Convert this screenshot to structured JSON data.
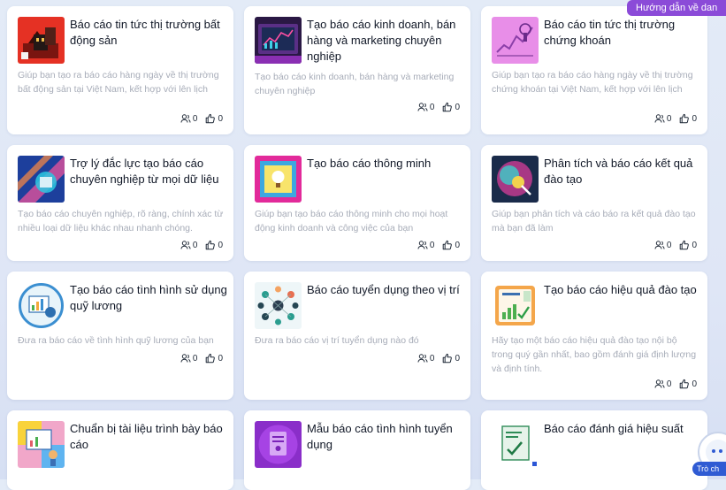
{
  "help_button": {
    "label": "Hướng dẫn về dan"
  },
  "chat_widget": {
    "label": "Trò ch"
  },
  "cards": [
    {
      "title": "Báo cáo tin tức thị trường bất động sản",
      "description": "Giúp bạn tạo ra báo cáo hàng ngày về thị trường bất động sản tại Việt Nam, kết hợp với lên lịch",
      "users": "0",
      "likes": "0",
      "icon": "real-estate-thumbnail"
    },
    {
      "title": "Tạo báo cáo kinh doanh, bán hàng và marketing chuyên nghiệp",
      "description": "Tạo báo cáo kinh doanh, bán hàng và marketing chuyên nghiệp",
      "users": "0",
      "likes": "0",
      "icon": "business-dashboard-thumbnail"
    },
    {
      "title": "Báo cáo tin tức thị trường chứng khoán",
      "description": "Giúp bạn tạo ra báo cáo hàng ngày về thị trường chứng khoán tại Việt Nam, kết hợp với lên lịch",
      "users": "0",
      "likes": "0",
      "icon": "stock-market-thumbnail"
    },
    {
      "title": "Trợ lý đắc lực tạo báo cáo chuyên nghiệp từ mọi dữ liệu",
      "description": "Tạo báo cáo chuyên nghiệp, rõ ràng, chính xác từ nhiều loại dữ liệu khác nhau nhanh chóng.",
      "users": "0",
      "likes": "0",
      "icon": "data-report-thumbnail"
    },
    {
      "title": "Tạo báo cáo thông minh",
      "description": "Giúp bạn tạo báo cáo thông minh cho mọi hoạt động kinh doanh và công việc của bạn",
      "users": "0",
      "likes": "0",
      "icon": "smart-report-thumbnail"
    },
    {
      "title": "Phân tích và báo cáo kết quả đào tạo",
      "description": "Giúp bạn phân tích và cáo báo ra kết quả đào tạo mà bạn đã làm",
      "users": "0",
      "likes": "0",
      "icon": "training-analysis-thumbnail"
    },
    {
      "title": "Tạo báo cáo tình hình sử dụng quỹ lương",
      "description": "Đưa ra báo cáo về tình hình quỹ lương của bạn",
      "users": "0",
      "likes": "0",
      "icon": "payroll-thumbnail"
    },
    {
      "title": "Báo cáo tuyển dụng theo vị trí",
      "description": "Đưa ra báo cáo vị trí tuyển dụng nào đó",
      "users": "0",
      "likes": "0",
      "icon": "recruitment-thumbnail"
    },
    {
      "title": "Tạo báo cáo hiệu quả đào tạo",
      "description": "Hãy tạo một báo cáo hiệu quả đào tạo nội bộ trong quý gần nhất, bao gồm đánh giá định lượng và định tính.",
      "users": "0",
      "likes": "0",
      "icon": "training-report-thumbnail"
    },
    {
      "title": "Chuẩn bị tài liệu trình bày báo cáo",
      "description": "",
      "users": "",
      "likes": "",
      "icon": "presentation-thumbnail"
    },
    {
      "title": "Mẫu báo cáo tình hình tuyển dụng",
      "description": "",
      "users": "",
      "likes": "",
      "icon": "hiring-template-thumbnail"
    },
    {
      "title": "Báo cáo đánh giá hiệu suất",
      "description": "",
      "users": "",
      "likes": "",
      "icon": "performance-thumbnail"
    }
  ]
}
